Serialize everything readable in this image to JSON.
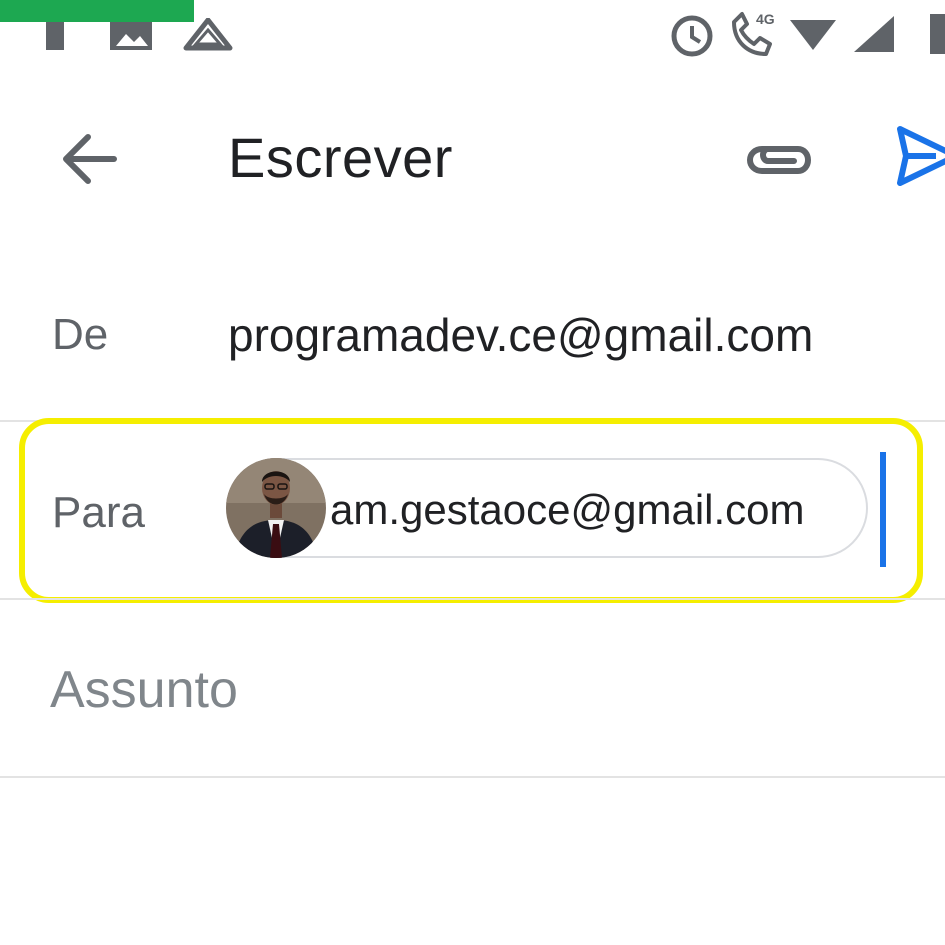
{
  "compose": {
    "title": "Escrever",
    "from_label": "De",
    "from_value": "programadev.ce@gmail.com",
    "to_label": "Para",
    "to_chip": "am.gestaoce@gmail.com",
    "subject_placeholder": "Assunto"
  },
  "status_bar": {
    "network_badge": "4G"
  },
  "colors": {
    "accent_blue": "#1a73e8",
    "highlight_yellow": "#f5ee00",
    "green_bar": "#1da851"
  },
  "icons": {
    "back": "arrow-back-icon",
    "attach": "paperclip-icon",
    "send": "send-icon"
  }
}
